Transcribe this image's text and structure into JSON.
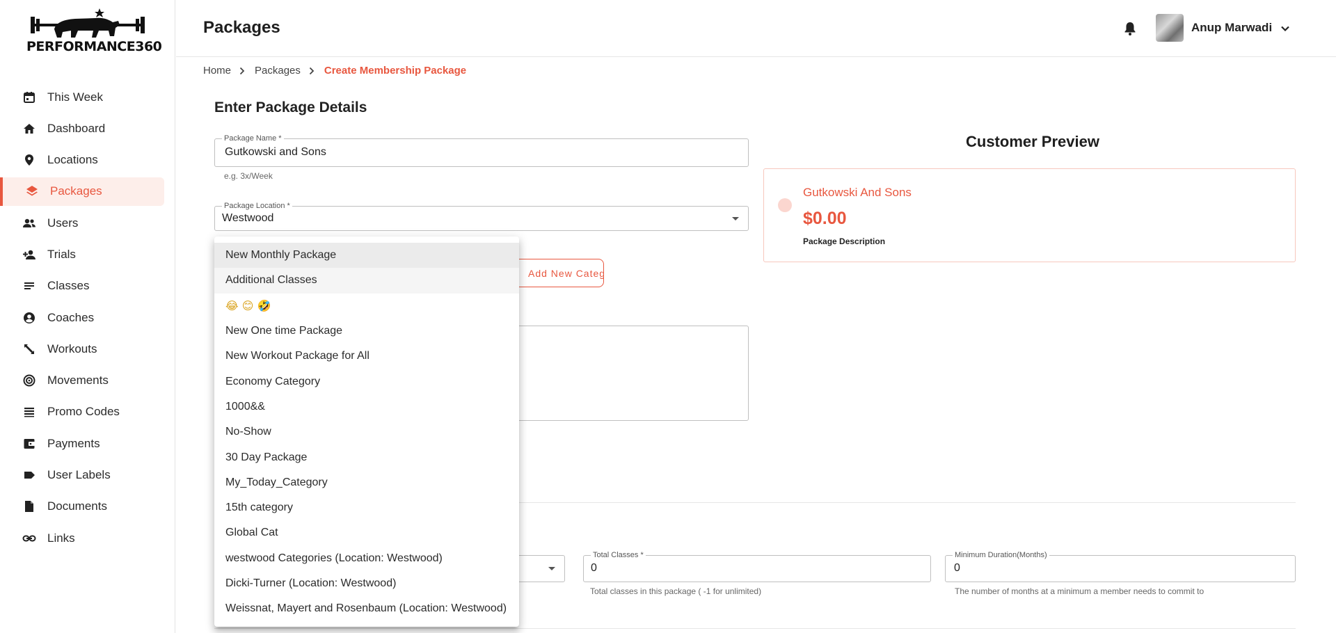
{
  "brand": {
    "logo_text": "PERFORMANCE360"
  },
  "sidebar": {
    "items": [
      {
        "label": "This Week",
        "icon": "calendar-icon"
      },
      {
        "label": "Dashboard",
        "icon": "home-icon"
      },
      {
        "label": "Locations",
        "icon": "location-pin-icon"
      },
      {
        "label": "Packages",
        "icon": "layers-icon",
        "active": true
      },
      {
        "label": "Users",
        "icon": "users-icon"
      },
      {
        "label": "Trials",
        "icon": "add-person-icon"
      },
      {
        "label": "Classes",
        "icon": "lines-icon"
      },
      {
        "label": "Coaches",
        "icon": "account-circle-icon"
      },
      {
        "label": "Workouts",
        "icon": "fitness-icon"
      },
      {
        "label": "Movements",
        "icon": "target-icon"
      },
      {
        "label": "Promo Codes",
        "icon": "list-icon"
      },
      {
        "label": "Payments",
        "icon": "wallet-icon"
      },
      {
        "label": "User Labels",
        "icon": "label-icon"
      },
      {
        "label": "Documents",
        "icon": "document-icon"
      },
      {
        "label": "Links",
        "icon": "link-icon"
      }
    ]
  },
  "header": {
    "title": "Packages",
    "user_name": "Anup Marwadi"
  },
  "breadcrumb": {
    "home": "Home",
    "packages": "Packages",
    "current": "Create Membership Package"
  },
  "form": {
    "section_title": "Enter Package Details",
    "package_name": {
      "label": "Package Name *",
      "value": "Gutkowski and Sons",
      "helper": "e.g. 3x/Week"
    },
    "package_location": {
      "label": "Package Location *",
      "value": "Westwood"
    },
    "add_category_label": "Add New Category",
    "total_classes": {
      "label": "Total Classes *",
      "value": "0",
      "helper": "Total classes in this package ( -1 for unlimited)"
    },
    "min_duration": {
      "label": "Minimum Duration(Months)",
      "value": "0",
      "helper": "The number of months at a minimum a member needs to commit to"
    }
  },
  "preview": {
    "title": "Customer Preview",
    "name": "Gutkowski And Sons",
    "price": "$0.00",
    "description": "Package Description"
  },
  "dropdown": {
    "options": [
      {
        "label": "New Monthly Package",
        "state": "selected"
      },
      {
        "label": "Additional Classes",
        "state": "hover"
      },
      {
        "label": "😂 😊 🤣",
        "emoji": true
      },
      {
        "label": "New One time Package"
      },
      {
        "label": "New Workout Package for All"
      },
      {
        "label": "Economy Category"
      },
      {
        "label": "1000&&"
      },
      {
        "label": "No-Show"
      },
      {
        "label": "30 Day Package"
      },
      {
        "label": "My_Today_Category"
      },
      {
        "label": "15th category"
      },
      {
        "label": "Global Cat"
      },
      {
        "label": "westwood Categories (Location: Westwood)"
      },
      {
        "label": "Dicki-Turner (Location: Westwood)"
      },
      {
        "label": "Weissnat, Mayert and Rosenbaum (Location: Westwood)"
      }
    ]
  },
  "colors": {
    "accent": "#e8573f",
    "accent_light": "#fdeeea",
    "border": "#bfbfbf"
  }
}
